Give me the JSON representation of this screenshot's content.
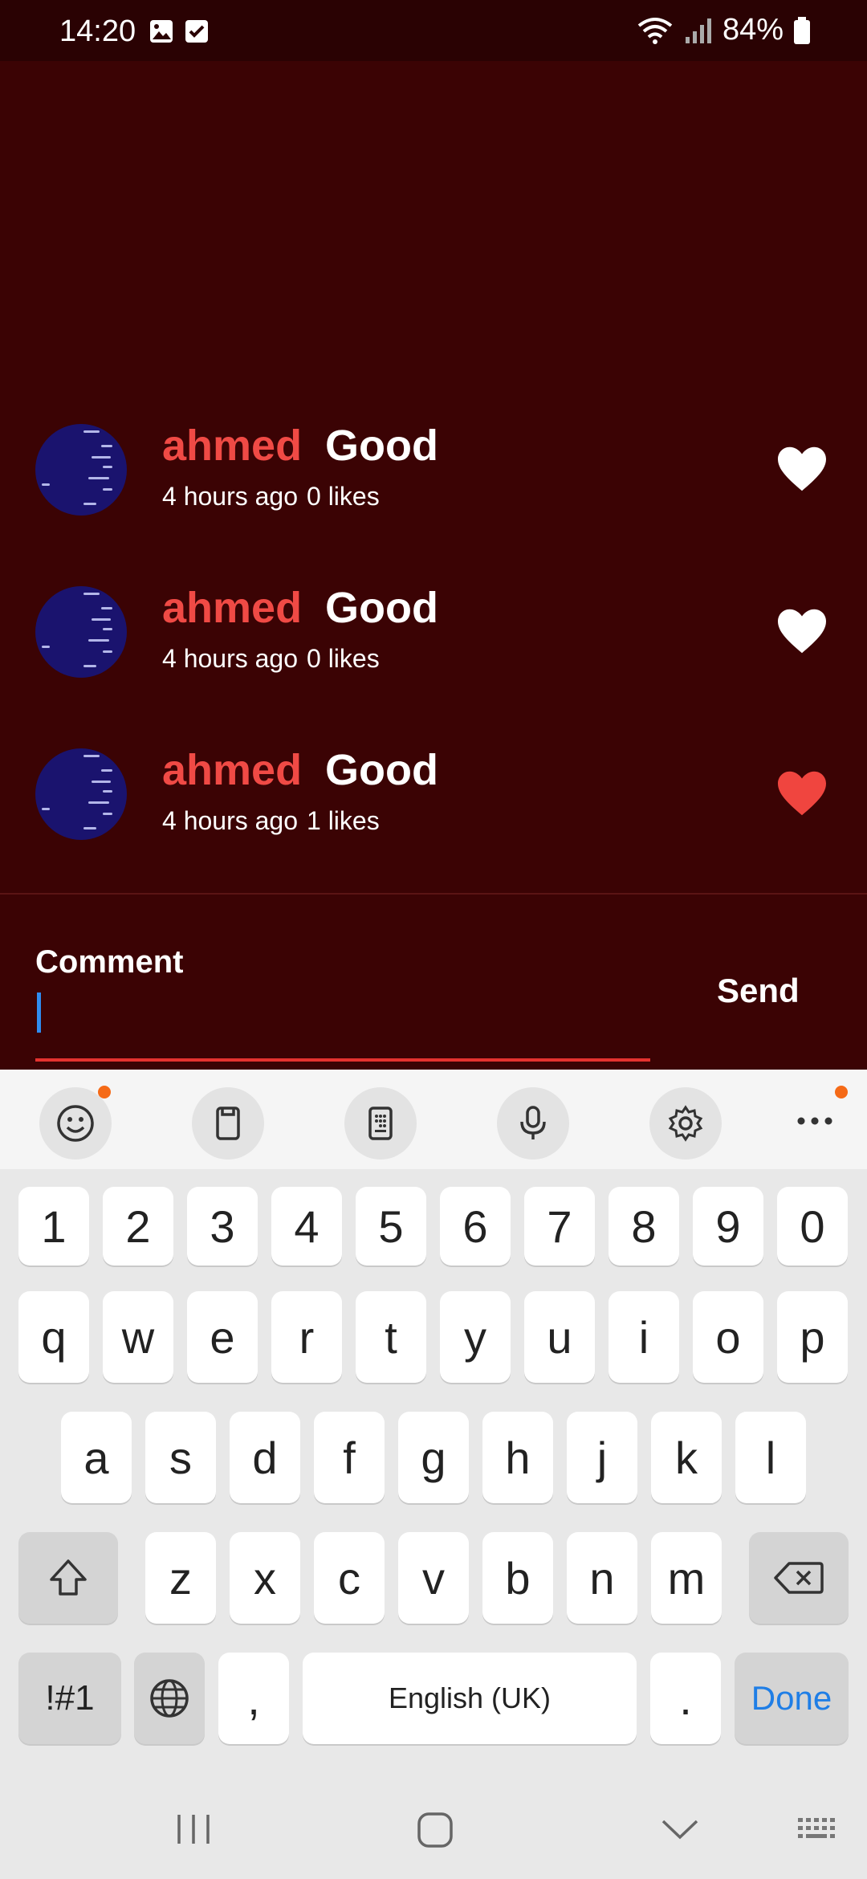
{
  "status_bar": {
    "time": "14:20",
    "battery": "84%"
  },
  "comments": [
    {
      "author": "ahmed",
      "text": "Good",
      "time": "4 hours ago",
      "likes": "0 likes",
      "liked": false
    },
    {
      "author": "ahmed",
      "text": "Good",
      "time": "4 hours ago",
      "likes": "0 likes",
      "liked": false
    },
    {
      "author": "ahmed",
      "text": "Good",
      "time": "4 hours ago",
      "likes": "1 likes",
      "liked": true
    }
  ],
  "composer": {
    "label": "Comment",
    "value": "",
    "send_label": "Send"
  },
  "keyboard": {
    "number_row": [
      "1",
      "2",
      "3",
      "4",
      "5",
      "6",
      "7",
      "8",
      "9",
      "0"
    ],
    "row1": [
      "q",
      "w",
      "e",
      "r",
      "t",
      "y",
      "u",
      "i",
      "o",
      "p"
    ],
    "row2": [
      "a",
      "s",
      "d",
      "f",
      "g",
      "h",
      "j",
      "k",
      "l"
    ],
    "row3": [
      "z",
      "x",
      "c",
      "v",
      "b",
      "n",
      "m"
    ],
    "symbols_label": "!#1",
    "comma": ",",
    "space_label": "English (UK)",
    "period": ".",
    "done_label": "Done"
  },
  "colors": {
    "background": "#3b0304",
    "author": "#f04a45",
    "heart_liked": "#f0453f",
    "accent": "#1f7ee6"
  }
}
